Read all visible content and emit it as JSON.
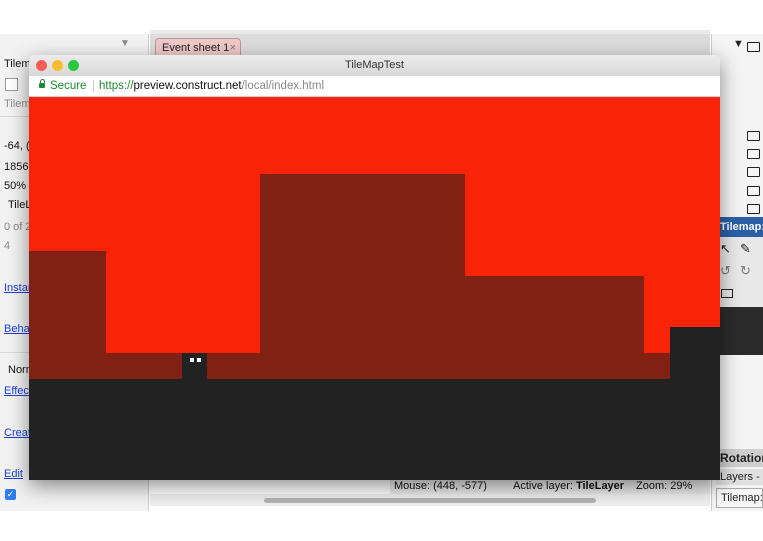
{
  "event_tab": {
    "label": "Event sheet 1",
    "close": "×"
  },
  "left_panel": {
    "rows": [
      {
        "text": "Tilem",
        "kind": "plain"
      },
      {
        "text": "Tilem",
        "kind": "grey"
      },
      {
        "text": "-64, (",
        "kind": "plain"
      },
      {
        "text": "1856",
        "kind": "plain"
      },
      {
        "text": "50%",
        "kind": "plain"
      },
      {
        "text": "TileL",
        "kind": "plain"
      },
      {
        "text": "0 of 2",
        "kind": "grey"
      },
      {
        "text": "4",
        "kind": "grey"
      },
      {
        "text": "Instan",
        "kind": "link"
      },
      {
        "text": "Beha",
        "kind": "link"
      },
      {
        "text": "Norm",
        "kind": "plain"
      },
      {
        "text": "Effec",
        "kind": "link"
      },
      {
        "text": "Creat",
        "kind": "link"
      },
      {
        "text": "Edit",
        "kind": "link"
      }
    ]
  },
  "browser": {
    "title": "TileMapTest",
    "secure_label": "Secure",
    "url_proto": "https://",
    "url_host": "preview.construct.net",
    "url_path": "/local/index.html",
    "traffic_colors": [
      "#fd5c55",
      "#febb2e",
      "#29c840"
    ]
  },
  "game": {
    "sky_color": "#f92407",
    "hill_color": "#812113",
    "ground_color": "#222222"
  },
  "status": {
    "mouse": "Mouse: (448, -577)",
    "active_layer_label": "Active layer: ",
    "active_layer_value": "TileLayer",
    "zoom": "Zoom: 29%"
  },
  "right_panel": {
    "tilemap_header": "Tilemap: T",
    "rotation": "Rotation",
    "layers": "Layers - ",
    "tilemap_button": "Tilemap:"
  }
}
